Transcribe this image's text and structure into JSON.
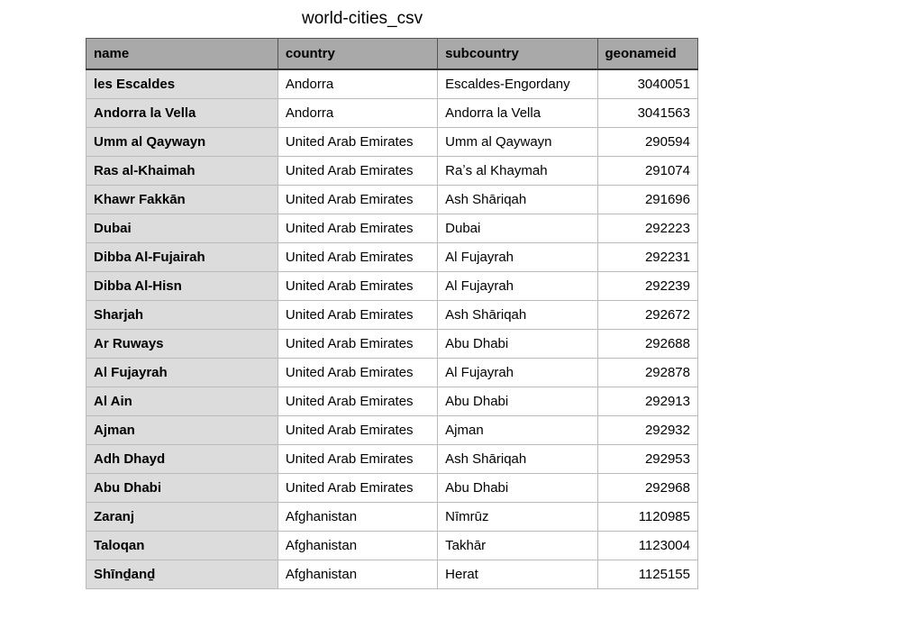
{
  "title": "world-cities_csv",
  "columns": [
    "name",
    "country",
    "subcountry",
    "geonameid"
  ],
  "rows": [
    {
      "name": "les Escaldes",
      "country": "Andorra",
      "subcountry": "Escaldes-Engordany",
      "geonameid": "3040051"
    },
    {
      "name": "Andorra la Vella",
      "country": "Andorra",
      "subcountry": "Andorra la Vella",
      "geonameid": "3041563"
    },
    {
      "name": "Umm al Qaywayn",
      "country": "United Arab Emirates",
      "subcountry": "Umm al Qaywayn",
      "geonameid": "290594"
    },
    {
      "name": "Ras al-Khaimah",
      "country": "United Arab Emirates",
      "subcountry": "Raʼs al Khaymah",
      "geonameid": "291074"
    },
    {
      "name": "Khawr Fakkān",
      "country": "United Arab Emirates",
      "subcountry": "Ash Shāriqah",
      "geonameid": "291696"
    },
    {
      "name": "Dubai",
      "country": "United Arab Emirates",
      "subcountry": "Dubai",
      "geonameid": "292223"
    },
    {
      "name": "Dibba Al-Fujairah",
      "country": "United Arab Emirates",
      "subcountry": "Al Fujayrah",
      "geonameid": "292231"
    },
    {
      "name": "Dibba Al-Hisn",
      "country": "United Arab Emirates",
      "subcountry": "Al Fujayrah",
      "geonameid": "292239"
    },
    {
      "name": "Sharjah",
      "country": "United Arab Emirates",
      "subcountry": "Ash Shāriqah",
      "geonameid": "292672"
    },
    {
      "name": "Ar Ruways",
      "country": "United Arab Emirates",
      "subcountry": "Abu Dhabi",
      "geonameid": "292688"
    },
    {
      "name": "Al Fujayrah",
      "country": "United Arab Emirates",
      "subcountry": "Al Fujayrah",
      "geonameid": "292878"
    },
    {
      "name": "Al Ain",
      "country": "United Arab Emirates",
      "subcountry": "Abu Dhabi",
      "geonameid": "292913"
    },
    {
      "name": "Ajman",
      "country": "United Arab Emirates",
      "subcountry": "Ajman",
      "geonameid": "292932"
    },
    {
      "name": "Adh Dhayd",
      "country": "United Arab Emirates",
      "subcountry": "Ash Shāriqah",
      "geonameid": "292953"
    },
    {
      "name": "Abu Dhabi",
      "country": "United Arab Emirates",
      "subcountry": "Abu Dhabi",
      "geonameid": "292968"
    },
    {
      "name": "Zaranj",
      "country": "Afghanistan",
      "subcountry": "Nīmrūz",
      "geonameid": "1120985"
    },
    {
      "name": "Taloqan",
      "country": "Afghanistan",
      "subcountry": "Takhār",
      "geonameid": "1123004"
    },
    {
      "name": "Shīnḏanḏ",
      "country": "Afghanistan",
      "subcountry": "Herat",
      "geonameid": "1125155"
    }
  ]
}
